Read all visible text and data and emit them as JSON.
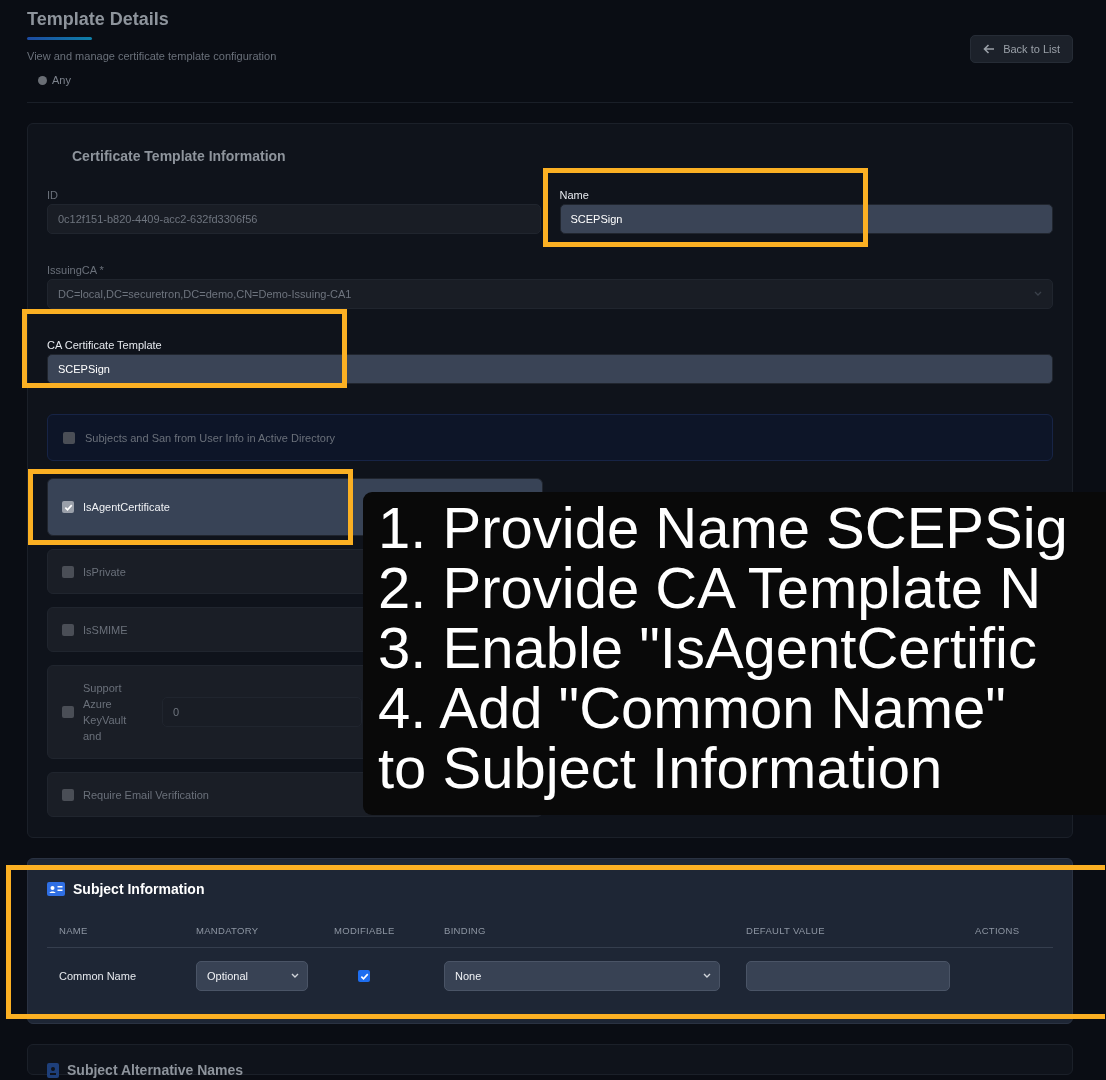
{
  "page": {
    "title": "Template Details",
    "subtitle": "View and manage certificate template configuration",
    "filter": {
      "label": "Any",
      "selected": false
    },
    "back_button": "Back to List"
  },
  "template_info": {
    "title": "Certificate Template Information",
    "field_rows": [
      [
        {
          "kind": "input",
          "label": "ID",
          "value": "0c12f151-b820-4409-acc2-632fd3306f56",
          "highlighted": false
        },
        {
          "kind": "input",
          "label": "Name",
          "value": "SCEPSign",
          "highlighted": true
        }
      ],
      [
        {
          "kind": "select",
          "label": "IssuingCA *",
          "value": "DC=local,DC=securetron,DC=demo,CN=Demo-Issuing-CA1",
          "highlighted": false
        }
      ],
      [
        {
          "kind": "input",
          "label": "CA Certificate Template",
          "value": "SCEPSign",
          "highlighted": true
        }
      ]
    ],
    "ad_option": {
      "label": "Subjects and San from User Info in Active Directory",
      "checked": false
    },
    "options": [
      {
        "kind": "checkbox",
        "label": "IsAgentCertificate",
        "checked": true,
        "highlighted": true
      },
      {
        "kind": "checkbox",
        "label": "IsPrivate",
        "checked": false,
        "highlighted": false
      },
      {
        "kind": "checkbox",
        "label": "IsSMIME",
        "checked": false,
        "highlighted": false
      },
      {
        "kind": "checkbox_input",
        "label": "Support Azure KeyVault and",
        "value": "0",
        "checked": false,
        "highlighted": false
      },
      {
        "kind": "checkbox",
        "label": "Require Email Verification",
        "checked": false,
        "highlighted": false
      }
    ]
  },
  "instructions": {
    "lines": [
      "1. Provide Name SCEPSig",
      "2. Provide CA Template N",
      "3. Enable \"IsAgentCertific",
      "4. Add \"Common Name\"",
      "to Subject Information"
    ]
  },
  "subject_info": {
    "title": "Subject Information",
    "highlighted": true,
    "columns": [
      "NAME",
      "MANDATORY",
      "MODIFIABLE",
      "BINDING",
      "DEFAULT VALUE",
      "ACTIONS"
    ],
    "rows": [
      {
        "name": "Common Name",
        "mandatory": "Optional",
        "modifiable": true,
        "binding": "None"
      }
    ]
  },
  "san": {
    "title": "Subject Alternative Names"
  }
}
